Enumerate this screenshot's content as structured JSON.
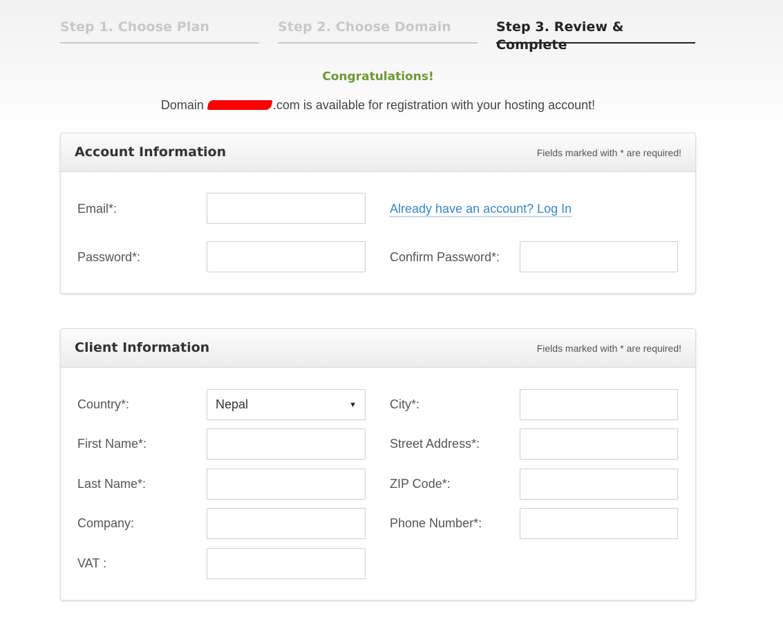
{
  "steps": [
    {
      "label": "Step 1. Choose Plan",
      "state": "inactive"
    },
    {
      "label": "Step 2. Choose Domain",
      "state": "inactive"
    },
    {
      "label": "Step 3. Review & Complete",
      "state": "active"
    }
  ],
  "message": {
    "title": "Congratulations!",
    "domain_prefix": "Domain",
    "domain_suffix": ".com is available for registration with your hosting account!"
  },
  "account": {
    "title": "Account Information",
    "required_note": "Fields marked with * are required!",
    "email_label": "Email*:",
    "email_value": "",
    "login_link": "Already have an account? Log In",
    "password_label": "Password*:",
    "password_value": "",
    "confirm_label": "Confirm Password*:",
    "confirm_value": ""
  },
  "client": {
    "title": "Client Information",
    "required_note": "Fields marked with * are required!",
    "country_label": "Country*:",
    "country_value": "Nepal",
    "first_name_label": "First Name*:",
    "last_name_label": "Last Name*:",
    "company_label": "Company:",
    "vat_label": "VAT :",
    "city_label": "City*:",
    "street_label": "Street Address*:",
    "zip_label": "ZIP Code*:",
    "phone_label": "Phone Number*:"
  },
  "colors": {
    "accent_link": "#3a87c4",
    "success": "#6b9a34",
    "active_step": "#222222",
    "inactive_step": "#c8c8c8"
  },
  "icons": {
    "select_caret": "caret-down-icon"
  }
}
